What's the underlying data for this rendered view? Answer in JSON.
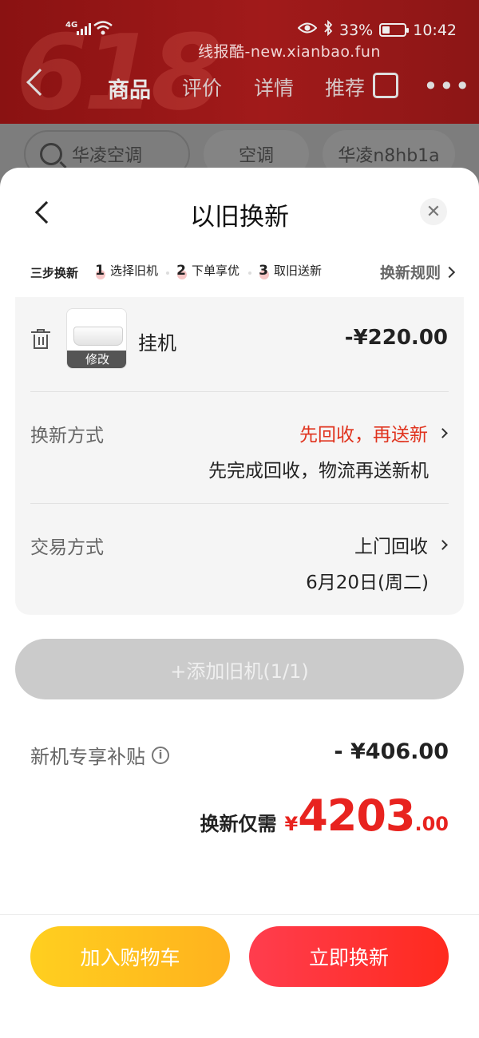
{
  "status_bar": {
    "network": "4G",
    "battery_percent": "33%",
    "battery_level": 0.33,
    "time": "10:42"
  },
  "watermark": "线报酷-new.xianbao.fun",
  "background": {
    "promo_text": "618",
    "nav_tabs": [
      "商品",
      "评价",
      "详情",
      "推荐"
    ],
    "active_tab": "商品",
    "search_text": "华凌空调",
    "chips": [
      "空调",
      "华凌n8hb1a"
    ]
  },
  "sheet": {
    "title": "以旧换新",
    "steps_label": "三步换新",
    "steps": [
      {
        "num": "1",
        "label": "选择旧机"
      },
      {
        "num": "2",
        "label": "下单享优"
      },
      {
        "num": "3",
        "label": "取旧送新"
      }
    ],
    "rules_link": "换新规则",
    "item": {
      "modify_label": "修改",
      "name": "挂机",
      "price": "-¥220.00"
    },
    "exchange_method": {
      "label": "换新方式",
      "value": "先回收，再送新",
      "desc": "先完成回收，物流再送新机"
    },
    "trade_method": {
      "label": "交易方式",
      "value": "上门回收",
      "date": "6月20日(周二)"
    },
    "add_button": "+添加旧机(1/1)",
    "subsidy": {
      "label": "新机专享补贴",
      "value": "- ¥406.00"
    },
    "total": {
      "label": "换新仅需",
      "currency": "¥",
      "integer": "4203",
      "decimal": ".00"
    },
    "buttons": {
      "cart": "加入购物车",
      "exchange": "立即换新"
    }
  },
  "colors": {
    "accent_red": "#e0331e",
    "cart_yellow": "#ffc41f",
    "buy_red": "#ff2f2f"
  }
}
